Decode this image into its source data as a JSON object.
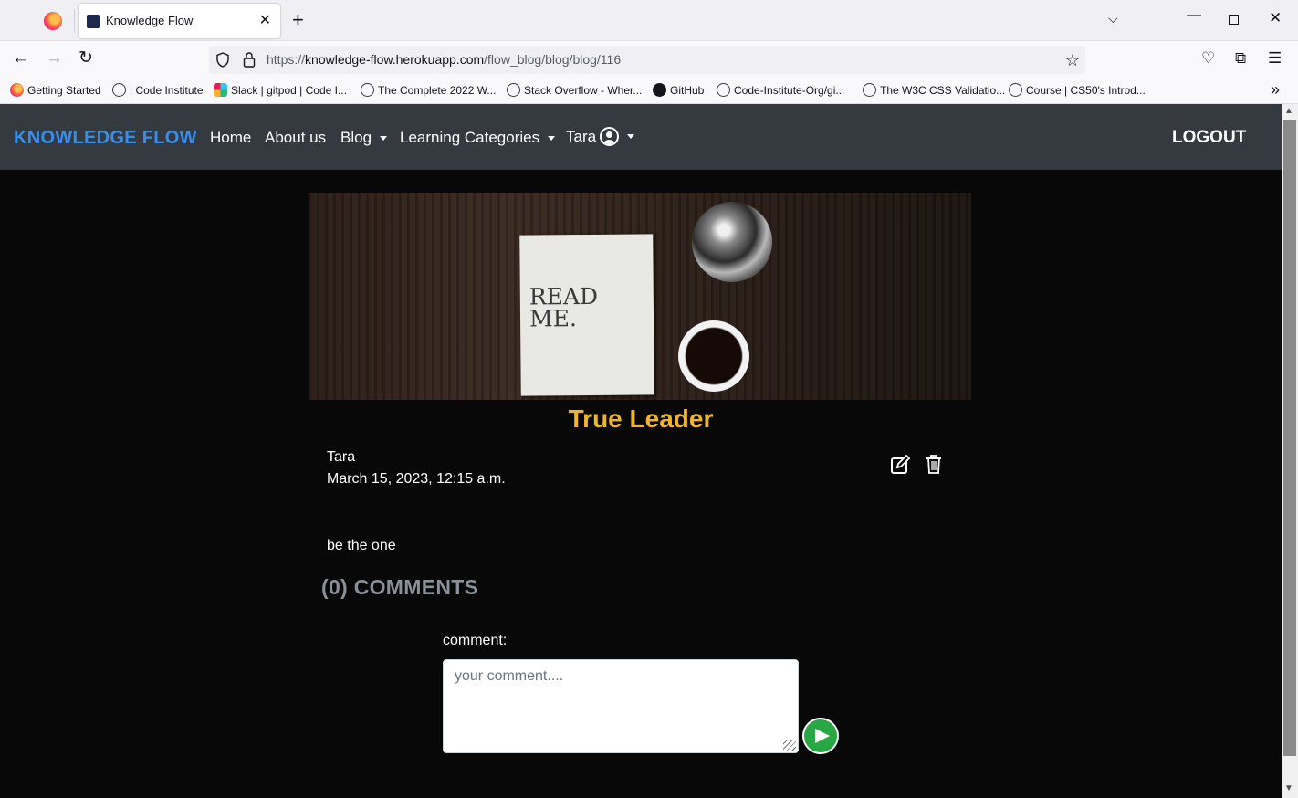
{
  "browser": {
    "tab_title": "Knowledge Flow",
    "url_prefix": "https://",
    "url_domain": "knowledge-flow.herokuapp.com",
    "url_path": "/flow_blog/blog/blog/116",
    "bookmarks": [
      {
        "label": "Getting Started",
        "icon": "firefox-icon"
      },
      {
        "label": "| Code Institute",
        "icon": "globe-icon"
      },
      {
        "label": "Slack | gitpod | Code I...",
        "icon": "slack-icon"
      },
      {
        "label": "The Complete 2022 W...",
        "icon": "globe-icon"
      },
      {
        "label": "Stack Overflow - Wher...",
        "icon": "globe-icon"
      },
      {
        "label": "GitHub",
        "icon": "github-icon"
      },
      {
        "label": "Code-Institute-Org/gi...",
        "icon": "globe-icon"
      },
      {
        "label": "The W3C CSS Validatio...",
        "icon": "globe-icon"
      },
      {
        "label": "Course | CS50's Introd...",
        "icon": "globe-icon"
      }
    ]
  },
  "site": {
    "brand": "KNOWLEDGE FLOW",
    "nav": {
      "home": "Home",
      "about": "About us",
      "blog": "Blog",
      "categories": "Learning Categories",
      "user": "Tara"
    },
    "logout": "LOGOUT"
  },
  "post": {
    "hero_text": "READ ME.",
    "title": "True Leader",
    "author": "Tara",
    "date": "March 15, 2023, 12:15 a.m.",
    "body": "be the one",
    "comments_heading": "(0) COMMENTS"
  },
  "comment_form": {
    "label": "comment:",
    "placeholder": "your comment...."
  },
  "colors": {
    "brand": "#3b8ee8",
    "title": "#f0b429",
    "send_button": "#28a745",
    "navbar": "#343a40"
  }
}
